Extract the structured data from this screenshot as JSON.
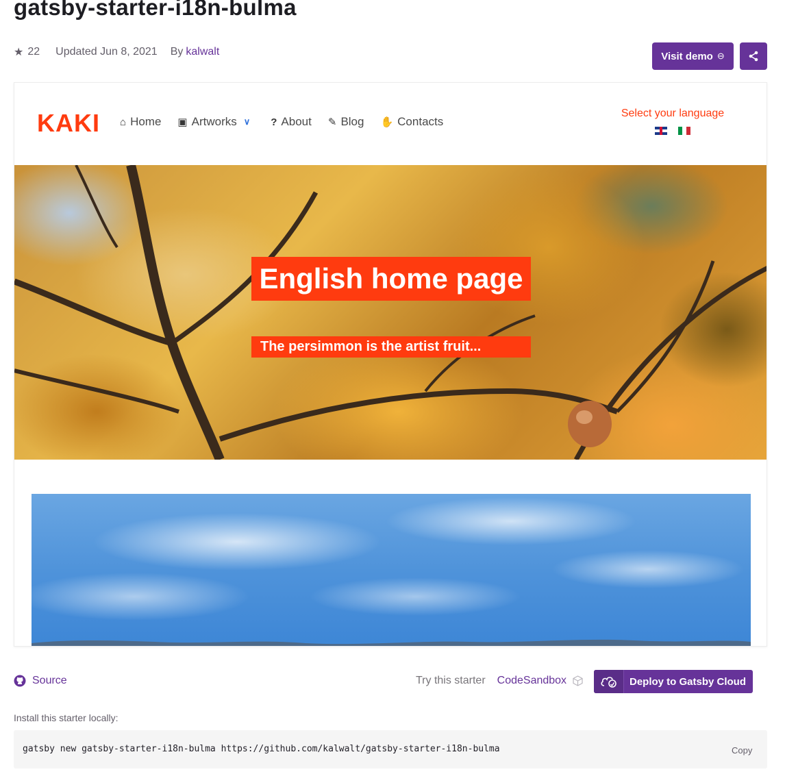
{
  "page": {
    "title": "gatsby-starter-i18n-bulma",
    "stars": "22",
    "updated": "Updated Jun 8, 2021",
    "by_label": "By",
    "author": "kalwalt"
  },
  "actions": {
    "visit_demo": "Visit demo",
    "share_icon": "share-icon"
  },
  "preview": {
    "logo": "KAKI",
    "nav": [
      {
        "icon": "home-icon",
        "label": "Home"
      },
      {
        "icon": "image-icon",
        "label": "Artworks"
      },
      {
        "icon": "question-icon",
        "label": "About"
      },
      {
        "icon": "pen-icon",
        "label": "Blog"
      },
      {
        "icon": "handshake-icon",
        "label": "Contacts"
      }
    ],
    "language_label": "Select your language",
    "hero_title": "English home page",
    "hero_subtitle": "The persimmon is the artist fruit...",
    "accent": "#ff3b0f"
  },
  "footer": {
    "source": "Source",
    "try_label": "Try this starter",
    "codesandbox": "CodeSandbox",
    "deploy": "Deploy to Gatsby Cloud",
    "install_label": "Install this starter locally:",
    "command": "gatsby new gatsby-starter-i18n-bulma https://github.com/kalwalt/gatsby-starter-i18n-bulma",
    "copy": "Copy"
  },
  "colors": {
    "brand": "#663399"
  }
}
